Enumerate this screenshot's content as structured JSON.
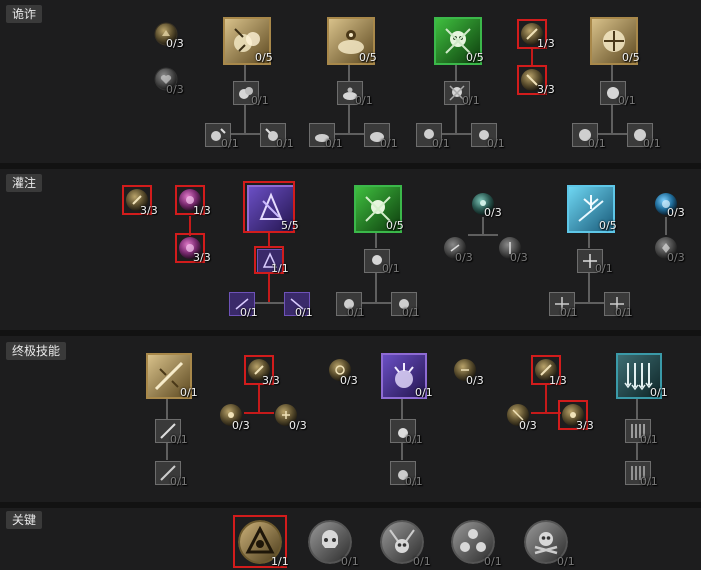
{
  "sections": {
    "deception": {
      "label": "诡诈"
    },
    "imbuement": {
      "label": "灌注"
    },
    "ultimate": {
      "label": "终极技能"
    },
    "key": {
      "label": "关键"
    }
  },
  "ranks": {
    "dec_orb1": "0/3",
    "dec_orb2": "0/3",
    "dec_b1": "0/5",
    "dec_b1_m": "0/1",
    "dec_b1_l": "0/1",
    "dec_b1_r": "0/1",
    "dec_b2": "0/5",
    "dec_b2_m": "0/1",
    "dec_b2_l": "0/1",
    "dec_b2_r": "0/1",
    "dec_b3": "0/5",
    "dec_b3_m": "0/1",
    "dec_b3_l": "0/1",
    "dec_b3_r": "0/1",
    "dec_orb3": "1/3",
    "dec_orb4": "3/3",
    "dec_b4": "0/5",
    "dec_b4_m": "0/1",
    "dec_b4_l": "0/1",
    "dec_b4_r": "0/1",
    "imb_orb1": "3/3",
    "imb_orb2": "1/3",
    "imb_orb3": "3/3",
    "imb_b1": "5/5",
    "imb_b1_m": "1/1",
    "imb_b1_l": "0/1",
    "imb_b1_r": "0/1",
    "imb_b2": "0/5",
    "imb_b2_m": "0/1",
    "imb_b2_l": "0/1",
    "imb_b2_r": "0/1",
    "imb_orb4": "0/3",
    "imb_orb5": "0/3",
    "imb_orb6": "0/3",
    "imb_b3": "0/5",
    "imb_b3_m": "0/1",
    "imb_b3_l": "0/1",
    "imb_b3_r": "0/1",
    "imb_orb7": "0/3",
    "imb_orb8": "0/3",
    "ult_b1": "0/1",
    "ult_b1_a": "0/1",
    "ult_b1_b": "0/1",
    "ult_orb1": "3/3",
    "ult_orb2": "0/3",
    "ult_orb3": "0/3",
    "ult_orb4": "0/3",
    "ult_b2": "0/1",
    "ult_b2_a": "0/1",
    "ult_b2_b": "0/1",
    "ult_orb5": "0/3",
    "ult_orb6": "1/3",
    "ult_orb7": "0/3",
    "ult_orb8": "3/3",
    "ult_b3": "0/1",
    "ult_b3_a": "0/1",
    "ult_b3_b": "0/1",
    "key_1": "1/1",
    "key_2": "0/1",
    "key_3": "0/1",
    "key_4": "0/1",
    "key_5": "0/1"
  },
  "colors": {
    "highlight": "#d21c1c",
    "gold_frame": "#a8884a",
    "purple_frame": "#8e6bd4",
    "green_frame": "#3bb84a",
    "cyan_frame": "#5ec7e8",
    "teal_frame": "#3a9aa8"
  }
}
